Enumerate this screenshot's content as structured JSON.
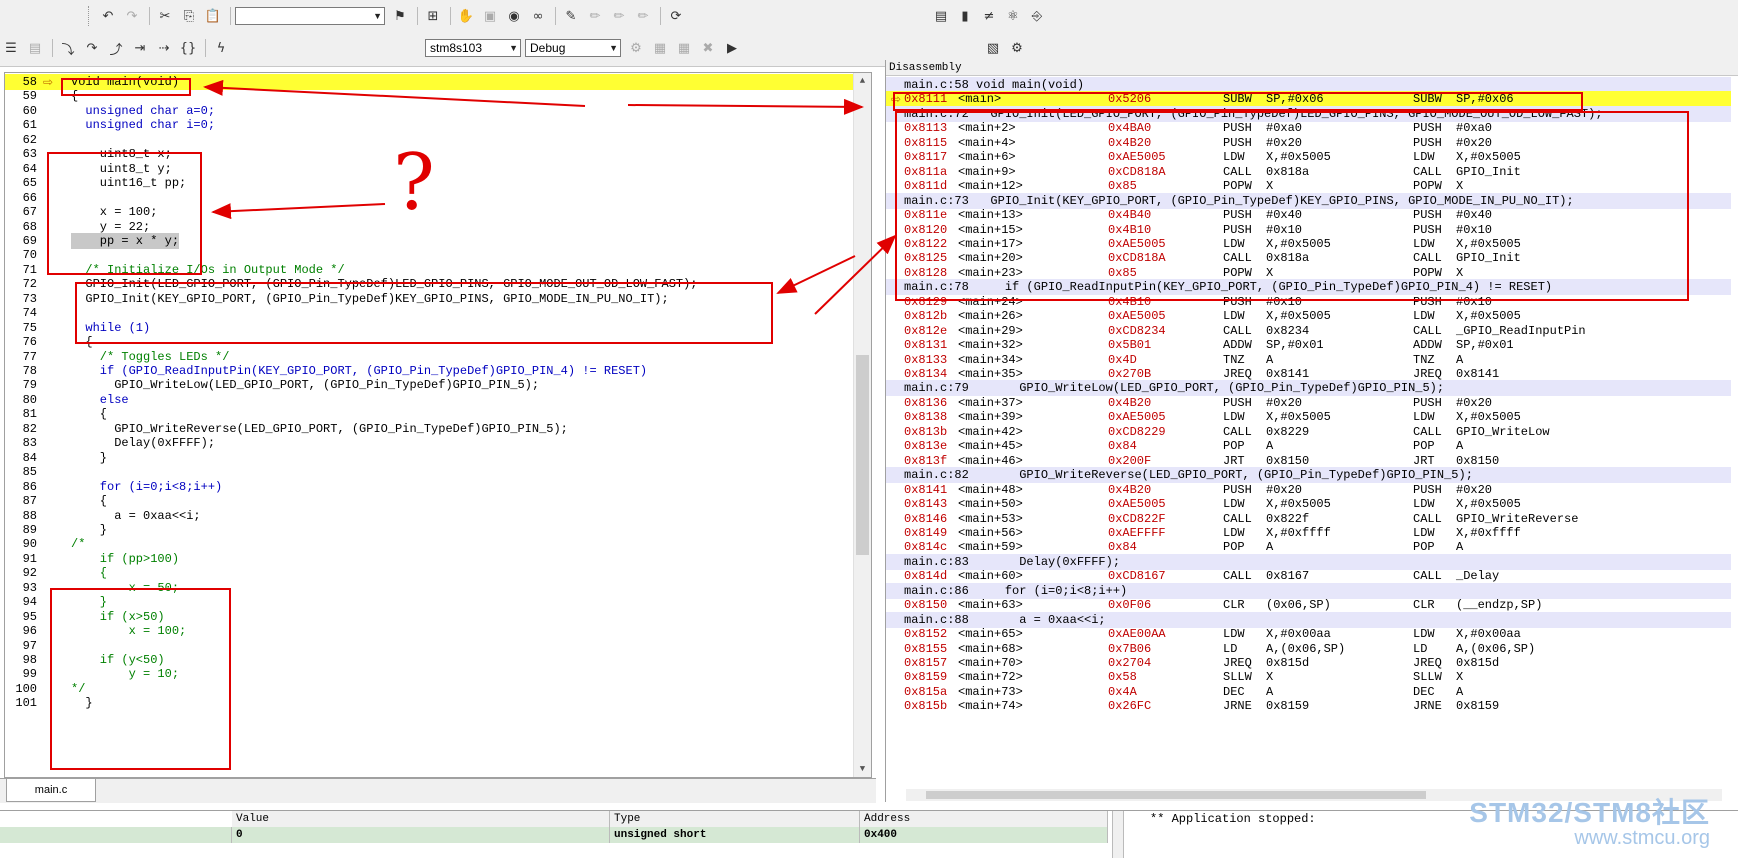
{
  "toolbar": {
    "find_value": "",
    "device_select": "stm8s103",
    "config_select": "Debug"
  },
  "editor": {
    "file_tab": "main.c",
    "lines": [
      {
        "n": "58",
        "code": "void main(void)",
        "style": "cur"
      },
      {
        "n": "59",
        "code": "{",
        "style": ""
      },
      {
        "n": "60",
        "code": "  unsigned char a=0;",
        "style": "kwline"
      },
      {
        "n": "61",
        "code": "  unsigned char i=0;",
        "style": "kwline"
      },
      {
        "n": "62",
        "code": "",
        "style": ""
      },
      {
        "n": "63",
        "code": "    uint8_t x;",
        "style": ""
      },
      {
        "n": "64",
        "code": "    uint8_t y;",
        "style": ""
      },
      {
        "n": "65",
        "code": "    uint16_t pp;",
        "style": ""
      },
      {
        "n": "66",
        "code": "",
        "style": ""
      },
      {
        "n": "67",
        "code": "    x = 100;",
        "style": ""
      },
      {
        "n": "68",
        "code": "    y = 22;",
        "style": ""
      },
      {
        "n": "69",
        "code": "    pp = x * y;",
        "style": "grey"
      },
      {
        "n": "70",
        "code": "",
        "style": ""
      },
      {
        "n": "71",
        "code": "  /* Initialize I/Os in Output Mode */",
        "style": "comment"
      },
      {
        "n": "72",
        "code": "  GPIO_Init(LED_GPIO_PORT, (GPIO_Pin_TypeDef)LED_GPIO_PINS, GPIO_MODE_OUT_OD_LOW_FAST);",
        "style": ""
      },
      {
        "n": "73",
        "code": "  GPIO_Init(KEY_GPIO_PORT, (GPIO_Pin_TypeDef)KEY_GPIO_PINS, GPIO_MODE_IN_PU_NO_IT);",
        "style": ""
      },
      {
        "n": "74",
        "code": "",
        "style": ""
      },
      {
        "n": "75",
        "code": "  while (1)",
        "style": "kwline"
      },
      {
        "n": "76",
        "code": "  {",
        "style": ""
      },
      {
        "n": "77",
        "code": "    /* Toggles LEDs */",
        "style": "comment"
      },
      {
        "n": "78",
        "code": "    if (GPIO_ReadInputPin(KEY_GPIO_PORT, (GPIO_Pin_TypeDef)GPIO_PIN_4) != RESET)",
        "style": "kwline"
      },
      {
        "n": "79",
        "code": "      GPIO_WriteLow(LED_GPIO_PORT, (GPIO_Pin_TypeDef)GPIO_PIN_5);",
        "style": ""
      },
      {
        "n": "80",
        "code": "    else",
        "style": "kwline"
      },
      {
        "n": "81",
        "code": "    {",
        "style": ""
      },
      {
        "n": "82",
        "code": "      GPIO_WriteReverse(LED_GPIO_PORT, (GPIO_Pin_TypeDef)GPIO_PIN_5);",
        "style": ""
      },
      {
        "n": "83",
        "code": "      Delay(0xFFFF);",
        "style": ""
      },
      {
        "n": "84",
        "code": "    }",
        "style": ""
      },
      {
        "n": "85",
        "code": "",
        "style": ""
      },
      {
        "n": "86",
        "code": "    for (i=0;i<8;i++)",
        "style": "kwline"
      },
      {
        "n": "87",
        "code": "    {",
        "style": ""
      },
      {
        "n": "88",
        "code": "      a = 0xaa<<i;",
        "style": ""
      },
      {
        "n": "89",
        "code": "    }",
        "style": ""
      },
      {
        "n": "90",
        "code": "/*",
        "style": "comment"
      },
      {
        "n": "91",
        "code": "    if (pp>100)",
        "style": "comment"
      },
      {
        "n": "92",
        "code": "    {",
        "style": "comment"
      },
      {
        "n": "93",
        "code": "        x = 50;",
        "style": "comment"
      },
      {
        "n": "94",
        "code": "    }",
        "style": "comment"
      },
      {
        "n": "95",
        "code": "    if (x>50)",
        "style": "comment"
      },
      {
        "n": "96",
        "code": "        x = 100;",
        "style": "comment"
      },
      {
        "n": "97",
        "code": "",
        "style": "comment"
      },
      {
        "n": "98",
        "code": "    if (y<50)",
        "style": "comment"
      },
      {
        "n": "99",
        "code": "        y = 10;",
        "style": "comment"
      },
      {
        "n": "100",
        "code": "*/",
        "style": "comment"
      },
      {
        "n": "101",
        "code": "  }",
        "style": ""
      }
    ],
    "annotation_question": "?"
  },
  "disassembly": {
    "title": "Disassembly",
    "rows": [
      {
        "t": "src",
        "text": "main.c:58 void main(void)"
      },
      {
        "t": "cur",
        "a": "0x8111",
        "l": "<main>",
        "o": "0x5206",
        "m": "SUBW",
        "p": "SP,#0x06",
        "m2": "SUBW",
        "p2": "SP,#0x06"
      },
      {
        "t": "src",
        "text": "main.c:72   GPIO_Init(LED_GPIO_PORT, (GPIO_Pin_TypeDef)LED_GPIO_PINS, GPIO_MODE_OUT_OD_LOW_FAST);"
      },
      {
        "t": "ins",
        "a": "0x8113",
        "l": "<main+2>",
        "o": "0x4BA0",
        "m": "PUSH",
        "p": "#0xa0",
        "m2": "PUSH",
        "p2": "#0xa0"
      },
      {
        "t": "ins",
        "a": "0x8115",
        "l": "<main+4>",
        "o": "0x4B20",
        "m": "PUSH",
        "p": "#0x20",
        "m2": "PUSH",
        "p2": "#0x20"
      },
      {
        "t": "ins",
        "a": "0x8117",
        "l": "<main+6>",
        "o": "0xAE5005",
        "m": "LDW",
        "p": "X,#0x5005",
        "m2": "LDW",
        "p2": "X,#0x5005"
      },
      {
        "t": "ins",
        "a": "0x811a",
        "l": "<main+9>",
        "o": "0xCD818A",
        "m": "CALL",
        "p": "0x818a",
        "m2": "CALL",
        "p2": "GPIO_Init"
      },
      {
        "t": "ins",
        "a": "0x811d",
        "l": "<main+12>",
        "o": "0x85",
        "m": "POPW",
        "p": "X",
        "m2": "POPW",
        "p2": "X"
      },
      {
        "t": "src",
        "text": "main.c:73   GPIO_Init(KEY_GPIO_PORT, (GPIO_Pin_TypeDef)KEY_GPIO_PINS, GPIO_MODE_IN_PU_NO_IT);"
      },
      {
        "t": "ins",
        "a": "0x811e",
        "l": "<main+13>",
        "o": "0x4B40",
        "m": "PUSH",
        "p": "#0x40",
        "m2": "PUSH",
        "p2": "#0x40"
      },
      {
        "t": "ins",
        "a": "0x8120",
        "l": "<main+15>",
        "o": "0x4B10",
        "m": "PUSH",
        "p": "#0x10",
        "m2": "PUSH",
        "p2": "#0x10"
      },
      {
        "t": "ins",
        "a": "0x8122",
        "l": "<main+17>",
        "o": "0xAE5005",
        "m": "LDW",
        "p": "X,#0x5005",
        "m2": "LDW",
        "p2": "X,#0x5005"
      },
      {
        "t": "ins",
        "a": "0x8125",
        "l": "<main+20>",
        "o": "0xCD818A",
        "m": "CALL",
        "p": "0x818a",
        "m2": "CALL",
        "p2": "GPIO_Init"
      },
      {
        "t": "ins",
        "a": "0x8128",
        "l": "<main+23>",
        "o": "0x85",
        "m": "POPW",
        "p": "X",
        "m2": "POPW",
        "p2": "X"
      },
      {
        "t": "src",
        "text": "main.c:78     if (GPIO_ReadInputPin(KEY_GPIO_PORT, (GPIO_Pin_TypeDef)GPIO_PIN_4) != RESET)"
      },
      {
        "t": "ins",
        "a": "0x8129",
        "l": "<main+24>",
        "o": "0x4B10",
        "m": "PUSH",
        "p": "#0x10",
        "m2": "PUSH",
        "p2": "#0x10"
      },
      {
        "t": "ins",
        "a": "0x812b",
        "l": "<main+26>",
        "o": "0xAE5005",
        "m": "LDW",
        "p": "X,#0x5005",
        "m2": "LDW",
        "p2": "X,#0x5005"
      },
      {
        "t": "ins",
        "a": "0x812e",
        "l": "<main+29>",
        "o": "0xCD8234",
        "m": "CALL",
        "p": "0x8234",
        "m2": "CALL",
        "p2": "_GPIO_ReadInputPin"
      },
      {
        "t": "ins",
        "a": "0x8131",
        "l": "<main+32>",
        "o": "0x5B01",
        "m": "ADDW",
        "p": "SP,#0x01",
        "m2": "ADDW",
        "p2": "SP,#0x01"
      },
      {
        "t": "ins",
        "a": "0x8133",
        "l": "<main+34>",
        "o": "0x4D",
        "m": "TNZ",
        "p": "A",
        "m2": "TNZ",
        "p2": "A"
      },
      {
        "t": "ins",
        "a": "0x8134",
        "l": "<main+35>",
        "o": "0x270B",
        "m": "JREQ",
        "p": "0x8141",
        "m2": "JREQ",
        "p2": "0x8141"
      },
      {
        "t": "src",
        "text": "main.c:79       GPIO_WriteLow(LED_GPIO_PORT, (GPIO_Pin_TypeDef)GPIO_PIN_5);"
      },
      {
        "t": "ins",
        "a": "0x8136",
        "l": "<main+37>",
        "o": "0x4B20",
        "m": "PUSH",
        "p": "#0x20",
        "m2": "PUSH",
        "p2": "#0x20"
      },
      {
        "t": "ins",
        "a": "0x8138",
        "l": "<main+39>",
        "o": "0xAE5005",
        "m": "LDW",
        "p": "X,#0x5005",
        "m2": "LDW",
        "p2": "X,#0x5005"
      },
      {
        "t": "ins",
        "a": "0x813b",
        "l": "<main+42>",
        "o": "0xCD8229",
        "m": "CALL",
        "p": "0x8229",
        "m2": "CALL",
        "p2": "GPIO_WriteLow"
      },
      {
        "t": "ins",
        "a": "0x813e",
        "l": "<main+45>",
        "o": "0x84",
        "m": "POP",
        "p": "A",
        "m2": "POP",
        "p2": "A"
      },
      {
        "t": "ins",
        "a": "0x813f",
        "l": "<main+46>",
        "o": "0x200F",
        "m": "JRT",
        "p": "0x8150",
        "m2": "JRT",
        "p2": "0x8150"
      },
      {
        "t": "src",
        "text": "main.c:82       GPIO_WriteReverse(LED_GPIO_PORT, (GPIO_Pin_TypeDef)GPIO_PIN_5);"
      },
      {
        "t": "ins",
        "a": "0x8141",
        "l": "<main+48>",
        "o": "0x4B20",
        "m": "PUSH",
        "p": "#0x20",
        "m2": "PUSH",
        "p2": "#0x20"
      },
      {
        "t": "ins",
        "a": "0x8143",
        "l": "<main+50>",
        "o": "0xAE5005",
        "m": "LDW",
        "p": "X,#0x5005",
        "m2": "LDW",
        "p2": "X,#0x5005"
      },
      {
        "t": "ins",
        "a": "0x8146",
        "l": "<main+53>",
        "o": "0xCD822F",
        "m": "CALL",
        "p": "0x822f",
        "m2": "CALL",
        "p2": "GPIO_WriteReverse"
      },
      {
        "t": "ins",
        "a": "0x8149",
        "l": "<main+56>",
        "o": "0xAEFFFF",
        "m": "LDW",
        "p": "X,#0xffff",
        "m2": "LDW",
        "p2": "X,#0xffff"
      },
      {
        "t": "ins",
        "a": "0x814c",
        "l": "<main+59>",
        "o": "0x84",
        "m": "POP",
        "p": "A",
        "m2": "POP",
        "p2": "A"
      },
      {
        "t": "src",
        "text": "main.c:83       Delay(0xFFFF);"
      },
      {
        "t": "ins",
        "a": "0x814d",
        "l": "<main+60>",
        "o": "0xCD8167",
        "m": "CALL",
        "p": "0x8167",
        "m2": "CALL",
        "p2": "_Delay"
      },
      {
        "t": "src",
        "text": "main.c:86     for (i=0;i<8;i++)"
      },
      {
        "t": "ins",
        "a": "0x8150",
        "l": "<main+63>",
        "o": "0x0F06",
        "m": "CLR",
        "p": "(0x06,SP)",
        "m2": "CLR",
        "p2": "(__endzp,SP)"
      },
      {
        "t": "src",
        "text": "main.c:88       a = 0xaa<<i;"
      },
      {
        "t": "ins",
        "a": "0x8152",
        "l": "<main+65>",
        "o": "0xAE00AA",
        "m": "LDW",
        "p": "X,#0x00aa",
        "m2": "LDW",
        "p2": "X,#0x00aa"
      },
      {
        "t": "ins",
        "a": "0x8155",
        "l": "<main+68>",
        "o": "0x7B06",
        "m": "LD",
        "p": "A,(0x06,SP)",
        "m2": "LD",
        "p2": "A,(0x06,SP)"
      },
      {
        "t": "ins",
        "a": "0x8157",
        "l": "<main+70>",
        "o": "0x2704",
        "m": "JREQ",
        "p": "0x815d",
        "m2": "JREQ",
        "p2": "0x815d"
      },
      {
        "t": "ins",
        "a": "0x8159",
        "l": "<main+72>",
        "o": "0x58",
        "m": "SLLW",
        "p": "X",
        "m2": "SLLW",
        "p2": "X"
      },
      {
        "t": "ins",
        "a": "0x815a",
        "l": "<main+73>",
        "o": "0x4A",
        "m": "DEC",
        "p": "A",
        "m2": "DEC",
        "p2": "A"
      },
      {
        "t": "ins",
        "a": "0x815b",
        "l": "<main+74>",
        "o": "0x26FC",
        "m": "JRNE",
        "p": "0x8159",
        "m2": "JRNE",
        "p2": "0x8159"
      }
    ]
  },
  "watch": {
    "headers": {
      "value": "Value",
      "type": "Type",
      "address": "Address"
    },
    "row": {
      "value": "0",
      "type": "unsigned short",
      "address": "0x400"
    }
  },
  "console": {
    "text": "** Application stopped:"
  },
  "watermark": {
    "line1": "STM32/STM8社区",
    "line2": "www.stmcu.org"
  },
  "colors": {
    "current_line": "#ffff33",
    "annotation": "#e00000",
    "source_row": "#e6e6fa",
    "address": "#c00000",
    "keyword": "#0000c0",
    "comment": "#008000"
  }
}
